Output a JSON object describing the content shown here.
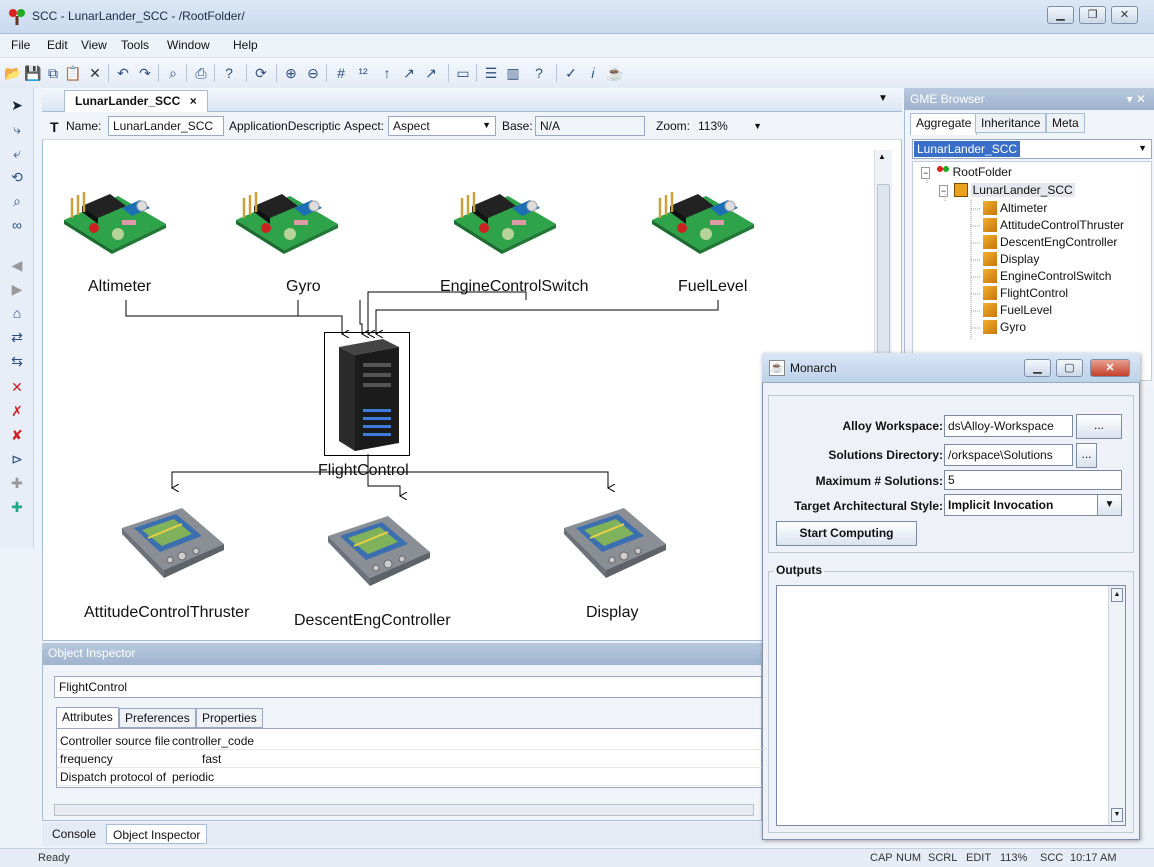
{
  "window": {
    "title": "SCC - LunarLander_SCC - /RootFolder/",
    "min_glyph": "▁",
    "max_glyph": "❐",
    "close_glyph": "✕"
  },
  "menu": [
    "File",
    "Edit",
    "View",
    "Tools",
    "Window",
    "Help"
  ],
  "editor": {
    "tab_label": "LunarLander_SCC",
    "tab_close": "×",
    "name_label": "Name:",
    "name_value": "LunarLander_SCC",
    "kind_value": "ApplicationDescriptic",
    "aspect_label": "Aspect:",
    "aspect_value": "Aspect",
    "base_label": "Base:",
    "base_value": "N/A",
    "zoom_label": "Zoom:",
    "zoom_value": "113%",
    "dropdown_glyph": "▼"
  },
  "diagram": {
    "nodes": {
      "altimeter": "Altimeter",
      "gyro": "Gyro",
      "engine_switch": "EngineControlSwitch",
      "fuel_level": "FuelLevel",
      "flight_control": "FlightControl",
      "attitude_thruster": "AttitudeControlThruster",
      "descent_controller": "DescentEngController",
      "display": "Display"
    }
  },
  "object_inspector": {
    "title": "Object Inspector",
    "object_name": "FlightControl",
    "tabs": [
      "Attributes",
      "Preferences",
      "Properties"
    ],
    "rows": [
      {
        "key": "Controller source file",
        "value": "controller_code"
      },
      {
        "key": "frequency",
        "value": "fast"
      },
      {
        "key": "Dispatch protocol of",
        "value": "periodic"
      }
    ]
  },
  "bottom_tabs": [
    "Console",
    "Object Inspector"
  ],
  "gme_browser": {
    "title": "GME Browser",
    "title_icons": "▾ ✕",
    "tabs": [
      "Aggregate",
      "Inheritance",
      "Meta"
    ],
    "combo_value": "LunarLander_SCC",
    "tree": {
      "root": "RootFolder",
      "model": "LunarLander_SCC",
      "children": [
        "Altimeter",
        "AttitudeControlThruster",
        "DescentEngController",
        "Display",
        "EngineControlSwitch",
        "FlightControl",
        "FuelLevel",
        "Gyro"
      ]
    }
  },
  "monarch": {
    "title": "Monarch",
    "alloy_workspace_label": "Alloy Workspace:",
    "alloy_workspace_value": "ds\\Alloy-Workspace",
    "solutions_dir_label": "Solutions Directory:",
    "solutions_dir_value": "/orkspace\\Solutions",
    "browse_label": "...",
    "max_solutions_label": "Maximum # Solutions:",
    "max_solutions_value": "5",
    "style_label": "Target Architectural Style:",
    "style_value": "Implicit Invocation",
    "start_button": "Start Computing",
    "outputs_label": "Outputs"
  },
  "status": {
    "text": "Ready",
    "indicators": [
      "CAP",
      "NUM",
      "SCRL",
      "EDIT",
      "113%",
      "SCC",
      "10:17 AM"
    ]
  }
}
